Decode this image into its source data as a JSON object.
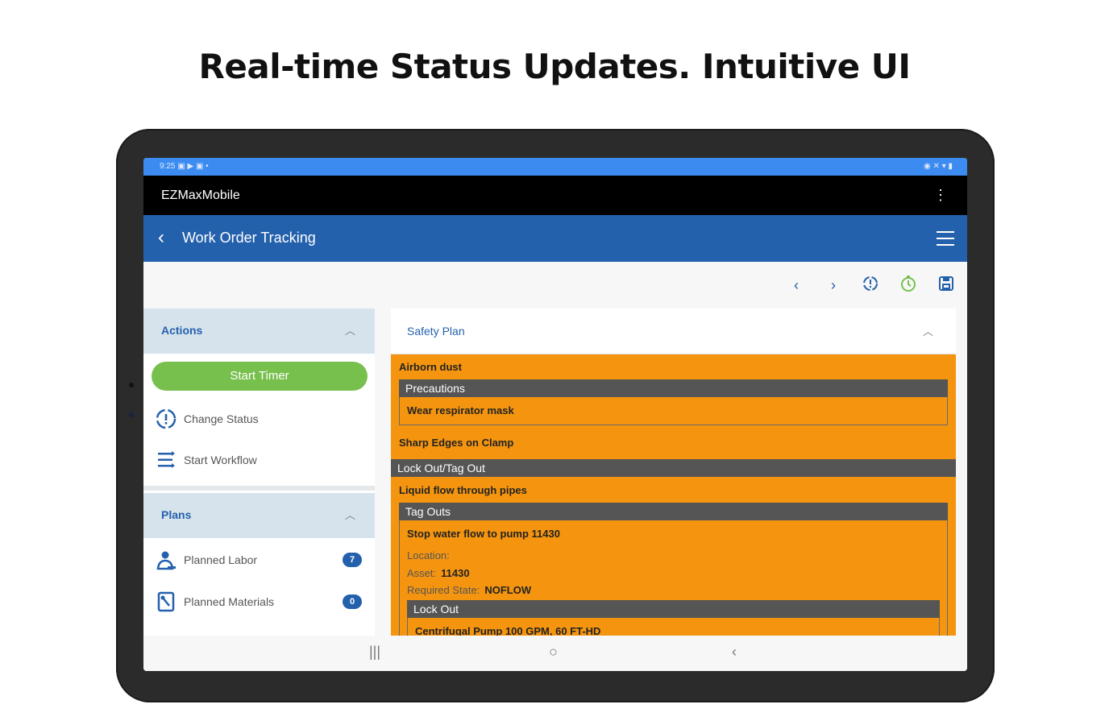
{
  "headline": "Real-time Status Updates. Intuitive UI",
  "status_bar": {
    "time": "9:25",
    "left_icons": "▣ ▶ ▣ •",
    "right_icons": "◉ ✕ ▾ ▮"
  },
  "app_bar": {
    "title": "EZMaxMobile"
  },
  "nav_bar": {
    "title": "Work Order Tracking"
  },
  "toolbar": {
    "icons": [
      "chevron-left-icon",
      "chevron-right-icon",
      "change-status-icon",
      "timer-icon",
      "save-icon"
    ]
  },
  "actions": {
    "title": "Actions",
    "start_timer": "Start Timer",
    "items": [
      {
        "label": "Change Status",
        "icon": "change-status-icon"
      },
      {
        "label": "Start Workflow",
        "icon": "workflow-icon"
      }
    ]
  },
  "plans": {
    "title": "Plans",
    "items": [
      {
        "label": "Planned Labor",
        "count": "7",
        "icon": "worker-icon"
      },
      {
        "label": "Planned Materials",
        "count": "0",
        "icon": "materials-icon"
      }
    ]
  },
  "safety_plan": {
    "title": "Safety Plan",
    "hazard1": "Airborn dust",
    "precautions_label": "Precautions",
    "precaution1": "Wear respirator mask",
    "hazard2": "Sharp Edges on Clamp",
    "lockout_section": "Lock Out/Tag Out",
    "hazard3": "Liquid flow through pipes",
    "tagouts_label": "Tag Outs",
    "tagout1": "Stop water flow to pump 11430",
    "location_label": "Location:",
    "asset_label": "Asset:",
    "asset_value": "11430",
    "required_state_label": "Required State:",
    "required_state_value": "NOFLOW",
    "lockout_label": "Lock Out",
    "lockout1": "Centrifugal Pump 100 GPM, 60 FT-HD"
  },
  "colors": {
    "nav_blue": "#2461ad",
    "timer_green": "#78c04d",
    "safety_orange": "#f5950f",
    "status_blue": "#3b8bf0"
  }
}
